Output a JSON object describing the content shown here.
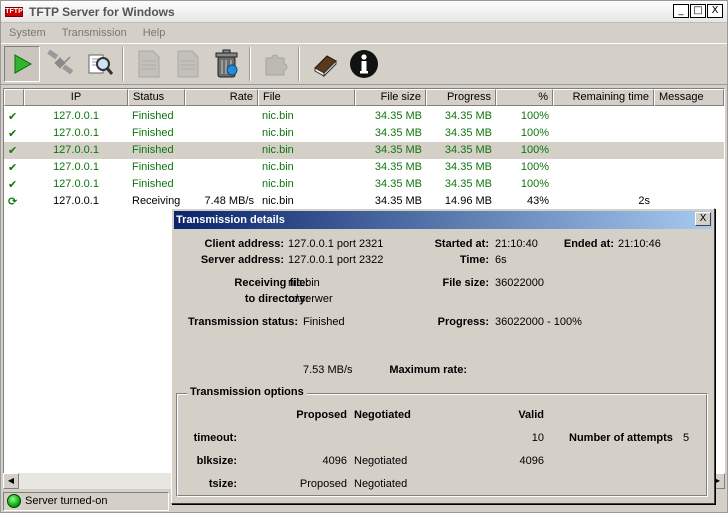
{
  "window": {
    "title": "TFTP Server for Windows",
    "app_icon_text": "TFTP",
    "minimize": "_",
    "maximize": "□",
    "close": "X"
  },
  "menu": [
    "System",
    "Transmission",
    "Help"
  ],
  "toolbar": [
    "start-icon",
    "satellite-icon",
    "search-icon",
    "document-icon",
    "document-icon",
    "trash-icon",
    "puzzle-icon",
    "book-icon",
    "info-icon"
  ],
  "columns": [
    "IP",
    "Status",
    "Rate",
    "File",
    "File size",
    "Progress",
    "%",
    "Remaining time",
    "Message"
  ],
  "rows": [
    {
      "icon": "check-icon",
      "ip": "127.0.0.1",
      "status": "Finished",
      "rate": "",
      "file": "nic.bin",
      "size": "34.35 MB",
      "progress": "34.35 MB",
      "pct": "100%",
      "remaining": "",
      "message": "",
      "state": "done",
      "selected": false
    },
    {
      "icon": "check-icon",
      "ip": "127.0.0.1",
      "status": "Finished",
      "rate": "",
      "file": "nic.bin",
      "size": "34.35 MB",
      "progress": "34.35 MB",
      "pct": "100%",
      "remaining": "",
      "message": "",
      "state": "done",
      "selected": false
    },
    {
      "icon": "check-icon",
      "ip": "127.0.0.1",
      "status": "Finished",
      "rate": "",
      "file": "nic.bin",
      "size": "34.35 MB",
      "progress": "34.35 MB",
      "pct": "100%",
      "remaining": "",
      "message": "",
      "state": "done",
      "selected": true
    },
    {
      "icon": "check-icon",
      "ip": "127.0.0.1",
      "status": "Finished",
      "rate": "",
      "file": "nic.bin",
      "size": "34.35 MB",
      "progress": "34.35 MB",
      "pct": "100%",
      "remaining": "",
      "message": "",
      "state": "done",
      "selected": false
    },
    {
      "icon": "check-icon",
      "ip": "127.0.0.1",
      "status": "Finished",
      "rate": "",
      "file": "nic.bin",
      "size": "34.35 MB",
      "progress": "34.35 MB",
      "pct": "100%",
      "remaining": "",
      "message": "",
      "state": "done",
      "selected": false
    },
    {
      "icon": "refresh-icon",
      "ip": "127.0.0.1",
      "status": "Receiving",
      "rate": "7.48 MB/s",
      "file": "nic.bin",
      "size": "34.35 MB",
      "progress": "14.96 MB",
      "pct": "43%",
      "remaining": "2s",
      "message": "",
      "state": "active",
      "selected": false
    }
  ],
  "statusbar": {
    "text": "Server turned-on"
  },
  "details": {
    "title": "Transmission details",
    "close": "X",
    "client_address_label": "Client address:",
    "client_address": "127.0.0.1 port 2321",
    "server_address_label": "Server address:",
    "server_address": "127.0.0.1 port 2322",
    "started_label": "Started at:",
    "started": "21:10:40",
    "ended_label": "Ended at:",
    "ended": "21:10:46",
    "time_label": "Time:",
    "time": "6s",
    "receiving_label": "Receiving file:",
    "receiving": "nic.bin",
    "directory_label": "to directory:",
    "directory": "c:\\serwer",
    "filesize_label": "File size:",
    "filesize": "36022000",
    "status_label": "Transmission status:",
    "status": "Finished",
    "progress_label": "Progress:",
    "progress": "36022000 - 100%",
    "maxrate_label": "Maximum rate:",
    "maxrate": "7.53 MB/s",
    "options": {
      "title": "Transmission options",
      "head_proposed": "Proposed",
      "head_negotiated": "Negotiated",
      "head_valid": "Valid",
      "timeout_label": "timeout:",
      "timeout_valid": "10",
      "attempts_label": "Number of attempts",
      "attempts": "5",
      "blksize_label": "blksize:",
      "blksize_proposed": "4096",
      "blksize_negotiated": "Negotiated",
      "blksize_valid": "4096",
      "tsize_label": "tsize:",
      "tsize_proposed": "Proposed",
      "tsize_negotiated": "Negotiated"
    }
  },
  "colors": {
    "finished": "#107510",
    "title_gradient_start": "#0a246a",
    "title_gradient_end": "#a6caf0"
  }
}
